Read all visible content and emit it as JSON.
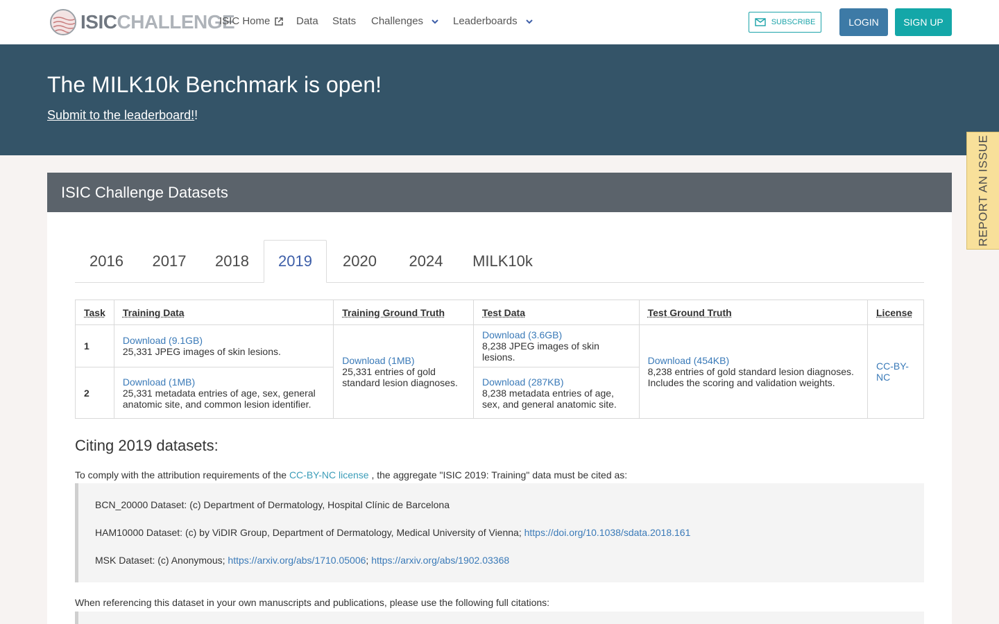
{
  "header": {
    "logo_isic": "ISIC",
    "logo_challenge": "CHALLENGE",
    "nav": {
      "home": "ISIC Home",
      "data": "Data",
      "stats": "Stats",
      "challenges": "Challenges",
      "leaderboards": "Leaderboards"
    },
    "subscribe": "SUBSCRIBE",
    "login": "LOGIN",
    "signup": "SIGN UP"
  },
  "banner": {
    "title": "The MILK10k Benchmark is open!",
    "link": "Submit to the leaderboard!",
    "suffix": "!"
  },
  "report_issue": "REPORT AN ISSUE",
  "card": {
    "title": "ISIC Challenge Datasets",
    "tabs": [
      "2016",
      "2017",
      "2018",
      "2019",
      "2020",
      "2024",
      "MILK10k"
    ],
    "active_tab": "2019"
  },
  "table": {
    "headers": [
      "Task",
      "Training Data",
      "Training Ground Truth",
      "Test Data",
      "Test Ground Truth",
      "License"
    ],
    "rows": [
      {
        "task": "1",
        "train_link": "Download (9.1GB)",
        "train_desc": "25,331 JPEG images of skin lesions.",
        "test_link": "Download (3.6GB)",
        "test_desc": "8,238 JPEG images of skin lesions."
      },
      {
        "task": "2",
        "train_link": "Download (1MB)",
        "train_desc": "25,331 metadata entries of age, sex, general anatomic site, and common lesion identifier.",
        "test_link": "Download (287KB)",
        "test_desc": "8,238 metadata entries of age, sex, and general anatomic site."
      }
    ],
    "train_gt_link": "Download (1MB)",
    "train_gt_desc": "25,331 entries of gold standard lesion diagnoses.",
    "test_gt_link": "Download (454KB)",
    "test_gt_desc": "8,238 entries of gold standard lesion diagnoses. Includes the scoring and validation weights.",
    "license": "CC-BY-NC"
  },
  "citing": {
    "title": "Citing 2019 datasets:",
    "intro_before": "To comply with the attribution requirements of the",
    "intro_link": "CC-BY-NC license",
    "intro_after": ", the aggregate \"ISIC 2019: Training\" data must be cited as:",
    "lines": [
      {
        "text": "BCN_20000 Dataset: (c) Department of Dermatology, Hospital Clínic de Barcelona"
      },
      {
        "text": "HAM10000 Dataset: (c) by ViDIR Group, Department of Dermatology, Medical University of Vienna;",
        "link1": "https://doi.org/10.1038/sdata.2018.161"
      },
      {
        "text": "MSK Dataset: (c) Anonymous;",
        "link1": "https://arxiv.org/abs/1710.05006",
        "sep": ";",
        "link2": "https://arxiv.org/abs/1902.03368"
      }
    ],
    "ref_intro": "When referencing this dataset in your own manuscripts and publications, please use the following full citations:"
  },
  "colors": {
    "banner": "#345468",
    "card_header": "#5b636b",
    "login": "#3d7aa6",
    "signup": "#14a7a8",
    "link": "#3a7ab8",
    "report": "#f8e09a"
  }
}
